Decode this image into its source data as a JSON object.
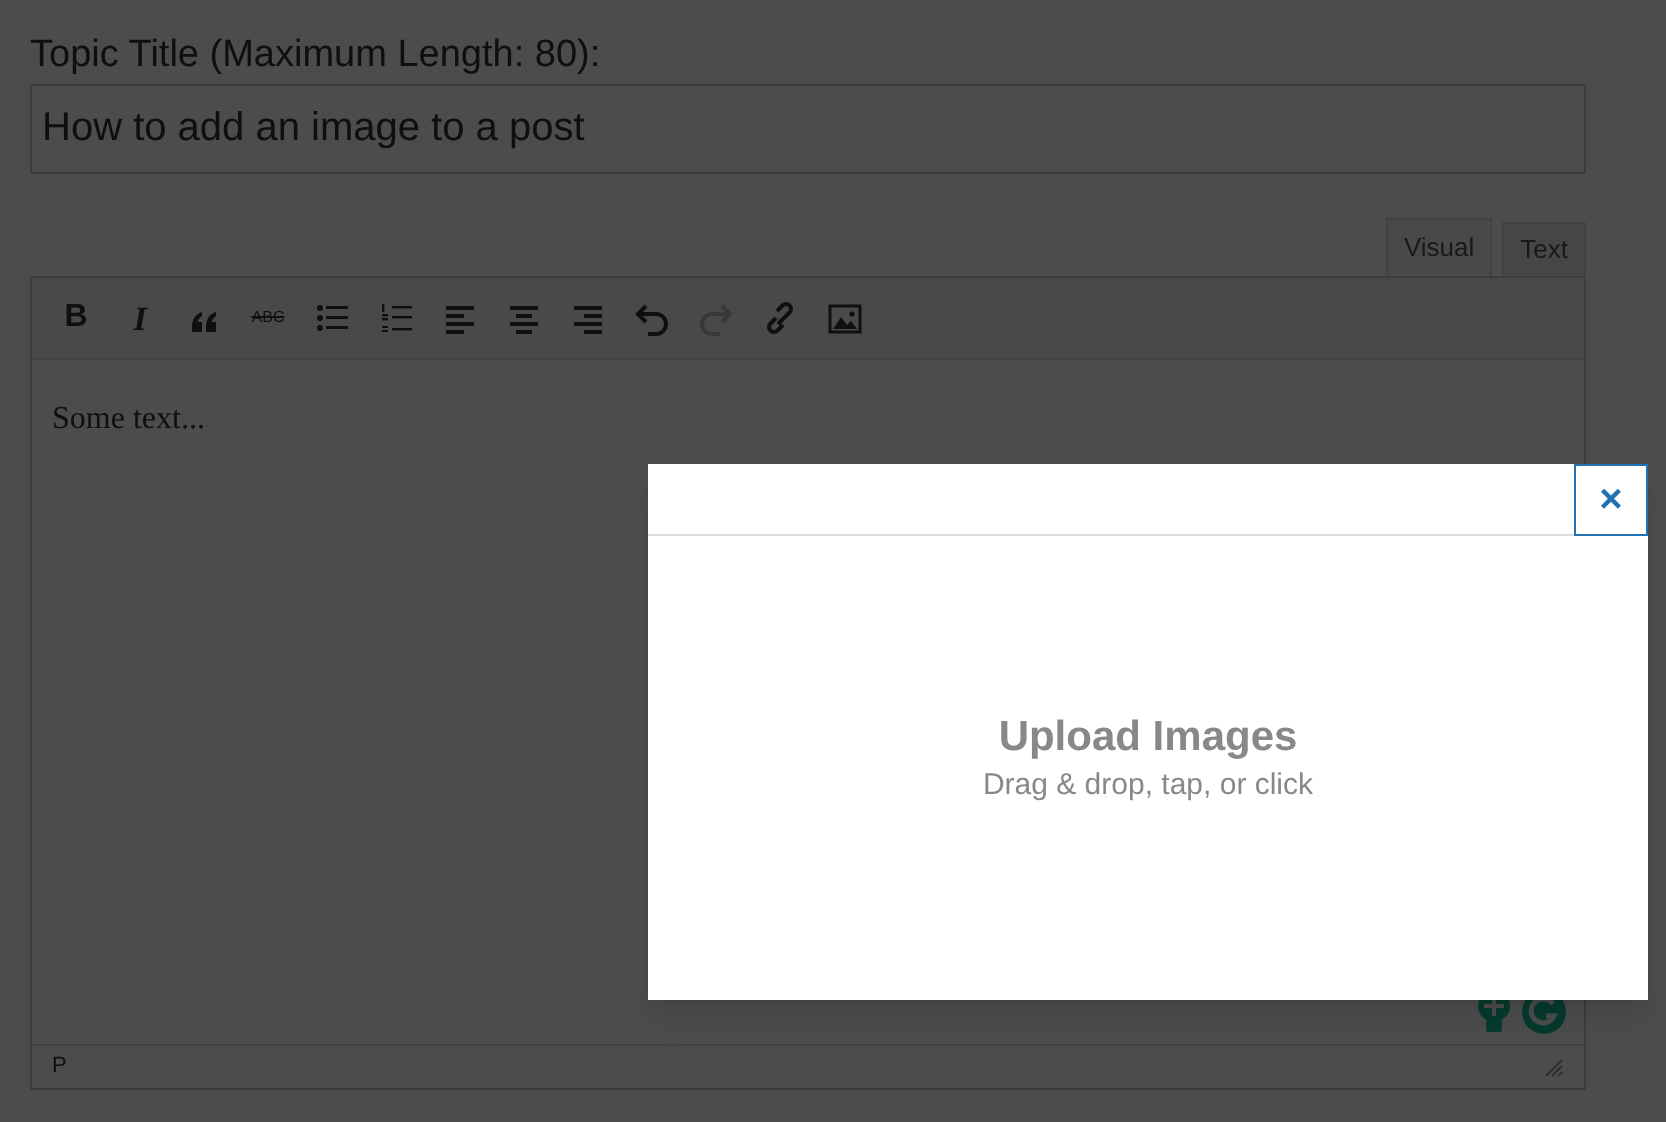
{
  "title_label": "Topic Title (Maximum Length: 80):",
  "title_field": {
    "value": "How to add an image to a post"
  },
  "editor_tabs": [
    {
      "label": "Visual",
      "selected": true
    },
    {
      "label": "Text",
      "selected": false
    }
  ],
  "toolbar": [
    {
      "kind": "bold",
      "label": "B",
      "disabled": false
    },
    {
      "kind": "italic",
      "label": "I",
      "disabled": false
    },
    {
      "kind": "quote",
      "disabled": false
    },
    {
      "kind": "strike",
      "label": "ABC",
      "disabled": false
    },
    {
      "kind": "bullets",
      "disabled": false
    },
    {
      "kind": "numbers",
      "disabled": false
    },
    {
      "kind": "align-left",
      "disabled": false
    },
    {
      "kind": "align-center",
      "disabled": false
    },
    {
      "kind": "align-right",
      "disabled": false
    },
    {
      "kind": "undo",
      "disabled": false
    },
    {
      "kind": "redo",
      "disabled": true
    },
    {
      "kind": "link",
      "disabled": false
    },
    {
      "kind": "image",
      "disabled": false
    }
  ],
  "editor_content": "Some text...",
  "status_path": "P",
  "modal": {
    "close": "×",
    "title": "Upload Images",
    "subtitle": "Drag & drop, tap, or click"
  }
}
